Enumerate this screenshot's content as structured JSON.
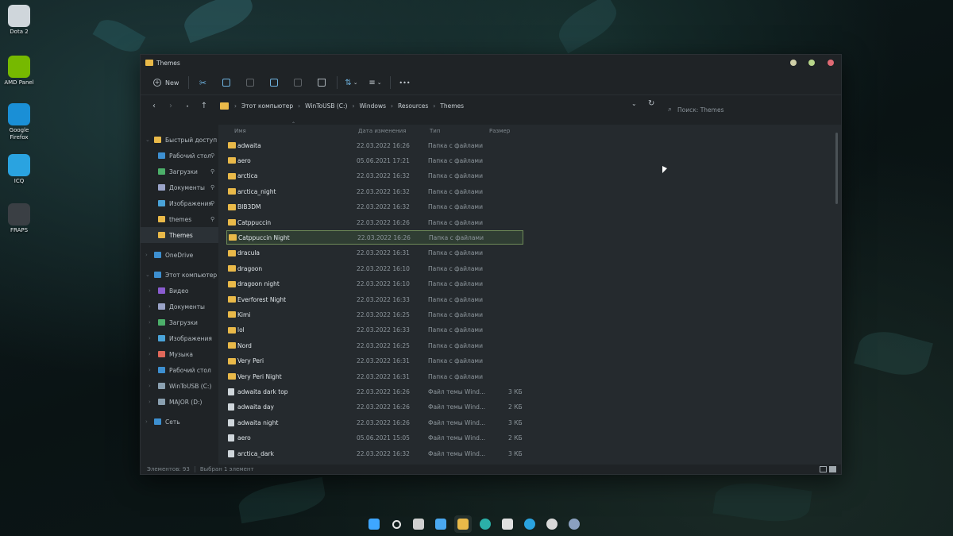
{
  "desktop": {
    "icons": [
      {
        "label": "Dota 2",
        "color": "#cfd6db"
      },
      {
        "label": "AMD Panel",
        "color": "#76b900"
      },
      {
        "label": "Google Firefox",
        "color": "#1a8fd6"
      },
      {
        "label": "ICQ",
        "color": "#2aa3e0"
      },
      {
        "label": "FRAPS",
        "color": "#3a3f44"
      }
    ]
  },
  "window": {
    "title": "Themes",
    "controls": {
      "minimize_color": "#cfcfa8",
      "maximize_color": "#b8d68a",
      "close_color": "#e06a74"
    }
  },
  "toolbar": {
    "new_label": "New",
    "buttons": [
      "cut-icon",
      "copy-icon",
      "paste-icon",
      "rename-icon",
      "share-icon",
      "delete-icon",
      "sort-icon",
      "view-icon",
      "more-icon"
    ],
    "more_glyph": "•••"
  },
  "address": {
    "crumbs": [
      "Этот компьютер",
      "WinToUSB (C:)",
      "Windows",
      "Resources",
      "Themes"
    ]
  },
  "search": {
    "placeholder": "Поиск: Themes"
  },
  "sidebar": {
    "items": [
      {
        "label": "Быстрый доступ",
        "icon": "star-icon",
        "color": "#e9b949",
        "indent": 0,
        "pinned": false,
        "arrow": "⌄"
      },
      {
        "label": "Рабочий стол",
        "icon": "desktop-icon",
        "color": "#3d8fd0",
        "indent": 1,
        "pinned": true
      },
      {
        "label": "Загрузки",
        "icon": "download-icon",
        "color": "#4caf6a",
        "indent": 1,
        "pinned": true
      },
      {
        "label": "Документы",
        "icon": "document-icon",
        "color": "#9aa3c8",
        "indent": 1,
        "pinned": true
      },
      {
        "label": "Изображения",
        "icon": "image-icon",
        "color": "#4aa3d8",
        "indent": 1,
        "pinned": true
      },
      {
        "label": "themes",
        "icon": "folder-icon",
        "color": "#e9b949",
        "indent": 1,
        "pinned": true
      },
      {
        "label": "Themes",
        "icon": "folder-icon",
        "color": "#e9b949",
        "indent": 1,
        "pinned": false,
        "selected": true
      },
      {
        "label": "OneDrive",
        "icon": "cloud-icon",
        "color": "#3d8fd0",
        "indent": 0,
        "pinned": false,
        "arrow": "›"
      },
      {
        "label": "Этот компьютер",
        "icon": "computer-icon",
        "color": "#3d8fd0",
        "indent": 0,
        "pinned": false,
        "arrow": "⌄"
      },
      {
        "label": "Видео",
        "icon": "video-icon",
        "color": "#8a5cd0",
        "indent": 1,
        "pinned": false,
        "arrow": "›"
      },
      {
        "label": "Документы",
        "icon": "document-icon",
        "color": "#9aa3c8",
        "indent": 1,
        "pinned": false,
        "arrow": "›"
      },
      {
        "label": "Загрузки",
        "icon": "download-icon",
        "color": "#4caf6a",
        "indent": 1,
        "pinned": false,
        "arrow": "›"
      },
      {
        "label": "Изображения",
        "icon": "image-icon",
        "color": "#4aa3d8",
        "indent": 1,
        "pinned": false,
        "arrow": "›"
      },
      {
        "label": "Музыка",
        "icon": "music-icon",
        "color": "#e0685a",
        "indent": 1,
        "pinned": false,
        "arrow": "›"
      },
      {
        "label": "Рабочий стол",
        "icon": "desktop-icon",
        "color": "#3d8fd0",
        "indent": 1,
        "pinned": false,
        "arrow": "›"
      },
      {
        "label": "WinToUSB (C:)",
        "icon": "drive-icon",
        "color": "#8aa0b0",
        "indent": 1,
        "pinned": false,
        "arrow": "›"
      },
      {
        "label": "MAJOR (D:)",
        "icon": "drive-icon",
        "color": "#8aa0b0",
        "indent": 1,
        "pinned": false,
        "arrow": "›"
      },
      {
        "label": "Сеть",
        "icon": "network-icon",
        "color": "#3d8fd0",
        "indent": 0,
        "pinned": false,
        "arrow": "›"
      }
    ]
  },
  "columns": {
    "name": "Имя",
    "date": "Дата изменения",
    "type": "Тип",
    "size": "Размер"
  },
  "files": [
    {
      "name": "adwaita",
      "date": "22.03.2022 16:26",
      "type": "Папка с файлами",
      "size": "",
      "kind": "folder"
    },
    {
      "name": "aero",
      "date": "05.06.2021 17:21",
      "type": "Папка с файлами",
      "size": "",
      "kind": "folder"
    },
    {
      "name": "arctica",
      "date": "22.03.2022 16:32",
      "type": "Папка с файлами",
      "size": "",
      "kind": "folder"
    },
    {
      "name": "arctica_night",
      "date": "22.03.2022 16:32",
      "type": "Папка с файлами",
      "size": "",
      "kind": "folder"
    },
    {
      "name": "BIB3DM",
      "date": "22.03.2022 16:32",
      "type": "Папка с файлами",
      "size": "",
      "kind": "folder"
    },
    {
      "name": "Catppuccin",
      "date": "22.03.2022 16:26",
      "type": "Папка с файлами",
      "size": "",
      "kind": "folder"
    },
    {
      "name": "Catppuccin Night",
      "date": "22.03.2022 16:26",
      "type": "Папка с файлами",
      "size": "",
      "kind": "folder",
      "selected": true
    },
    {
      "name": "dracula",
      "date": "22.03.2022 16:31",
      "type": "Папка с файлами",
      "size": "",
      "kind": "folder"
    },
    {
      "name": "dragoon",
      "date": "22.03.2022 16:10",
      "type": "Папка с файлами",
      "size": "",
      "kind": "folder"
    },
    {
      "name": "dragoon night",
      "date": "22.03.2022 16:10",
      "type": "Папка с файлами",
      "size": "",
      "kind": "folder"
    },
    {
      "name": "Everforest Night",
      "date": "22.03.2022 16:33",
      "type": "Папка с файлами",
      "size": "",
      "kind": "folder"
    },
    {
      "name": "Kimi",
      "date": "22.03.2022 16:25",
      "type": "Папка с файлами",
      "size": "",
      "kind": "folder"
    },
    {
      "name": "lol",
      "date": "22.03.2022 16:33",
      "type": "Папка с файлами",
      "size": "",
      "kind": "folder"
    },
    {
      "name": "Nord",
      "date": "22.03.2022 16:25",
      "type": "Папка с файлами",
      "size": "",
      "kind": "folder"
    },
    {
      "name": "Very Peri",
      "date": "22.03.2022 16:31",
      "type": "Папка с файлами",
      "size": "",
      "kind": "folder"
    },
    {
      "name": "Very Peri Night",
      "date": "22.03.2022 16:31",
      "type": "Папка с файлами",
      "size": "",
      "kind": "folder"
    },
    {
      "name": "adwaita dark top",
      "date": "22.03.2022 16:26",
      "type": "Файл темы Wind...",
      "size": "3 КБ",
      "kind": "file"
    },
    {
      "name": "adwaita day",
      "date": "22.03.2022 16:26",
      "type": "Файл темы Wind...",
      "size": "2 КБ",
      "kind": "file"
    },
    {
      "name": "adwaita night",
      "date": "22.03.2022 16:26",
      "type": "Файл темы Wind...",
      "size": "3 КБ",
      "kind": "file"
    },
    {
      "name": "aero",
      "date": "05.06.2021 15:05",
      "type": "Файл темы Wind...",
      "size": "2 КБ",
      "kind": "file"
    },
    {
      "name": "arctica_dark",
      "date": "22.03.2022 16:32",
      "type": "Файл темы Wind...",
      "size": "3 КБ",
      "kind": "file"
    }
  ],
  "status": {
    "count": "Элементов: 93",
    "selected": "Выбран 1 элемент"
  },
  "taskbar": {
    "apps": [
      {
        "name": "start-icon",
        "color": "#3ea6ff"
      },
      {
        "name": "search-icon",
        "color": "#e6e6e6"
      },
      {
        "name": "task-view-icon",
        "color": "#d0d0d0"
      },
      {
        "name": "widgets-icon",
        "color": "#4aa8f0"
      },
      {
        "name": "file-explorer-icon",
        "color": "#e9b949",
        "active": true
      },
      {
        "name": "edge-icon",
        "color": "#2bb0a8"
      },
      {
        "name": "store-icon",
        "color": "#e0e0e0"
      },
      {
        "name": "telegram-icon",
        "color": "#2aa3e0"
      },
      {
        "name": "chrome-icon",
        "color": "#d9d9d9"
      },
      {
        "name": "settings-icon",
        "color": "#8aa0c0"
      }
    ]
  }
}
